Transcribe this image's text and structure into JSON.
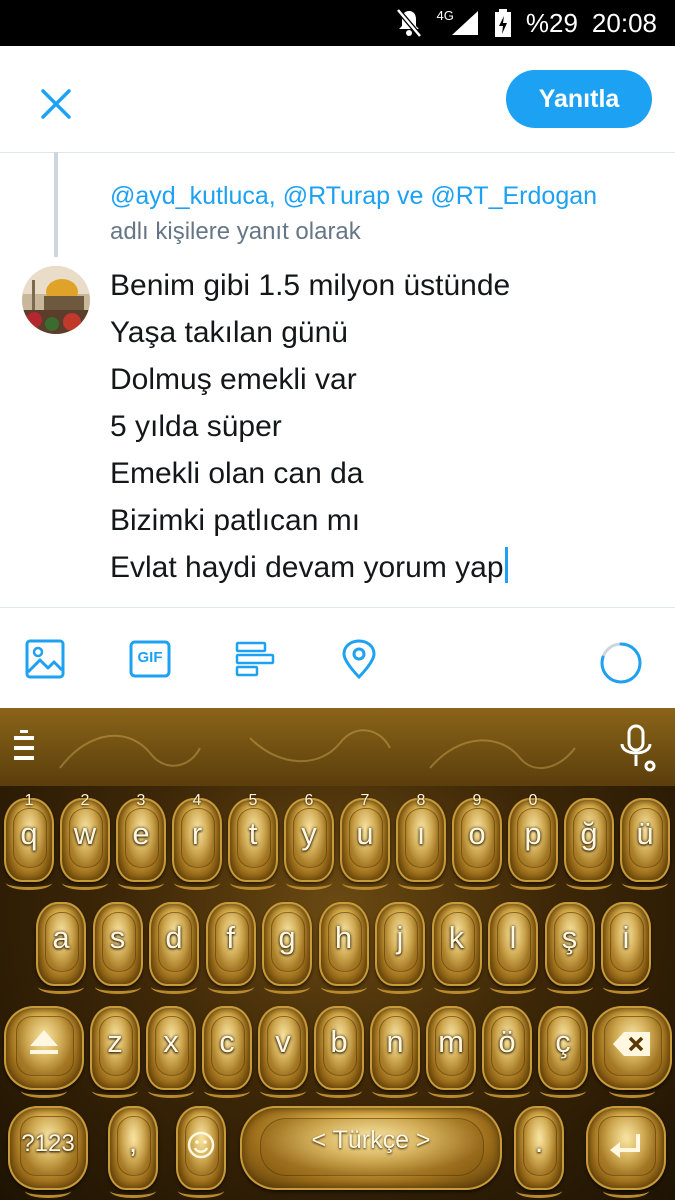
{
  "status_bar": {
    "network": "4G",
    "battery": "%29",
    "time": "20:08",
    "icons": [
      "notifications-off-icon",
      "signal-icon",
      "battery-charging-icon"
    ]
  },
  "header": {
    "close_icon": "close-icon",
    "reply_button_label": "Yanıtla",
    "accent_color": "#1da1f2"
  },
  "reply_context": {
    "mentions": "@ayd_kutluca, @RTurap ve @RT_Erdogan",
    "note": "adlı kişilere yanıt olarak"
  },
  "tweet": {
    "lines": [
      "Benim gibi 1.5 milyon üstünde",
      "Yaşa takılan günü",
      "Dolmuş emekli var",
      "5 yılda süper",
      "Emekli olan can da",
      "Bizimki patlıcan mı",
      "Evlat haydi devam yorum yap"
    ]
  },
  "toolbar": {
    "items": [
      "image-icon",
      "gif-icon",
      "poll-icon",
      "location-icon"
    ],
    "gif_label": "GIF",
    "character_progress": 0.8
  },
  "keyboard": {
    "row1": [
      {
        "key": "q",
        "num": "1"
      },
      {
        "key": "w",
        "num": "2"
      },
      {
        "key": "e",
        "num": "3"
      },
      {
        "key": "r",
        "num": "4"
      },
      {
        "key": "t",
        "num": "5"
      },
      {
        "key": "y",
        "num": "6"
      },
      {
        "key": "u",
        "num": "7"
      },
      {
        "key": "ı",
        "num": "8"
      },
      {
        "key": "o",
        "num": "9"
      },
      {
        "key": "p",
        "num": "0"
      },
      {
        "key": "ğ",
        "num": ""
      },
      {
        "key": "ü",
        "num": ""
      }
    ],
    "row2": [
      "a",
      "s",
      "d",
      "f",
      "g",
      "h",
      "j",
      "k",
      "l",
      "ş",
      "i"
    ],
    "row3": [
      "z",
      "x",
      "c",
      "v",
      "b",
      "n",
      "m",
      "ö",
      "ç"
    ],
    "symbols_label": "?123",
    "comma_label": ",",
    "space_label": "<  Türkçe  >",
    "period_label": "."
  }
}
